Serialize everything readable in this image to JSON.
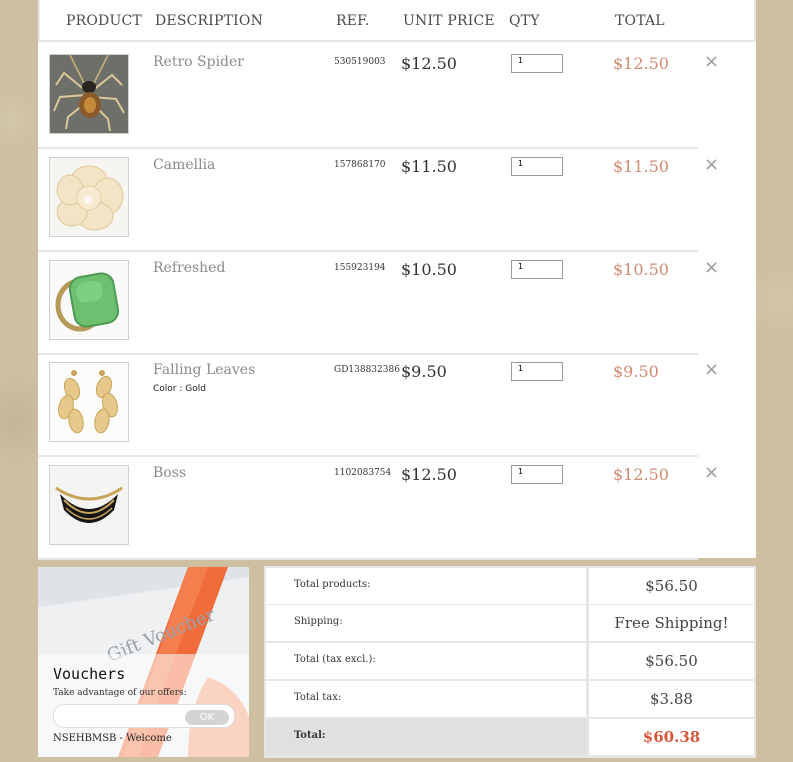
{
  "table": {
    "headers": {
      "product": "PRODUCT",
      "description": "DESCRIPTION",
      "ref": "REF.",
      "unit_price": "UNIT PRICE",
      "qty": "QTY",
      "total": "TOTAL"
    },
    "remove_icon": "×",
    "items": [
      {
        "name": "Retro Spider",
        "attr": "",
        "ref": "530519003",
        "price": "$12.50",
        "qty": "1",
        "total": "$12.50",
        "image": "spider-necklace"
      },
      {
        "name": "Camellia",
        "attr": "",
        "ref": "157868170",
        "price": "$11.50",
        "qty": "1",
        "total": "$11.50",
        "image": "camellia-flower-brooch"
      },
      {
        "name": "Refreshed",
        "attr": "",
        "ref": "155923194",
        "price": "$10.50",
        "qty": "1",
        "total": "$10.50",
        "image": "green-stone-ring"
      },
      {
        "name": "Falling Leaves",
        "attr": "Color : Gold",
        "ref": "GD138832386",
        "price": "$9.50",
        "qty": "1",
        "total": "$9.50",
        "image": "gold-leaf-earrings"
      },
      {
        "name": "Boss",
        "attr": "",
        "ref": "1102083754",
        "price": "$12.50",
        "qty": "1",
        "total": "$12.50",
        "image": "black-gold-necklace"
      }
    ]
  },
  "voucher": {
    "art_text": "Gift Voucher",
    "title": "Vouchers",
    "subtitle": "Take advantage of our offers:",
    "input_value": "",
    "ok_label": "OK",
    "code_line": "NSEHBMSB - Welcome"
  },
  "summary": {
    "rows": [
      {
        "label": "Total products:",
        "value": "$56.50"
      },
      {
        "label": "Shipping:",
        "value": "Free Shipping!"
      },
      {
        "label": "Total (tax excl.):",
        "value": "$56.50"
      },
      {
        "label": "Total tax:",
        "value": "$3.88"
      },
      {
        "label": "Total:",
        "value": "$60.38"
      }
    ]
  },
  "colors": {
    "background": "#cdbf9f",
    "line_total": "#d08a72",
    "grand_total": "#d5583c"
  }
}
